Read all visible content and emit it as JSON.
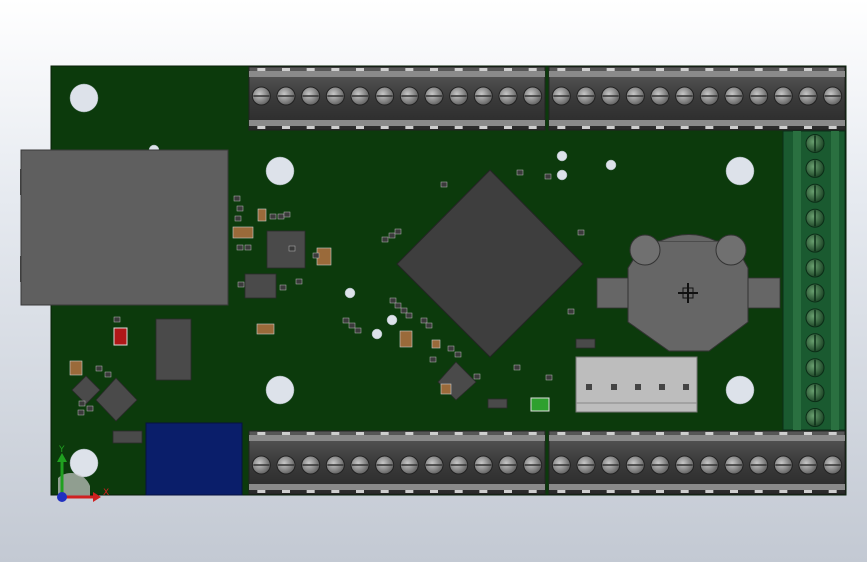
{
  "viewport": {
    "background": "gradient-white-to-gray"
  },
  "board": {
    "pcb_color": "#0c3a0c",
    "components": {
      "ethernet_jack": "rj45-connector",
      "mcu": "qfp-main-chip",
      "battery_holder": "coin-cell-holder",
      "header": "5-pin-header",
      "blue_module": "blue-module",
      "terminal_blocks": "screw-terminal-blocks"
    }
  },
  "triad": {
    "y_label": "Y",
    "x_label": "X",
    "x_color": "#d02020",
    "y_color": "#20a020",
    "z_color": "#2030c0"
  }
}
